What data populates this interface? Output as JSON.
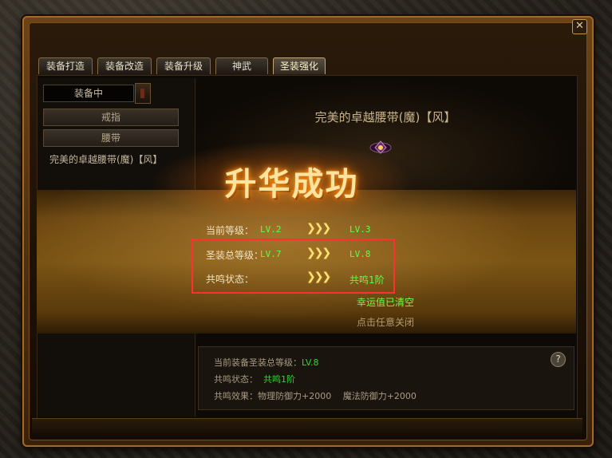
{
  "window": {
    "close_symbol": "✕"
  },
  "tabs": [
    {
      "label": "装备打造",
      "active": false
    },
    {
      "label": "装备改造",
      "active": false
    },
    {
      "label": "装备升级",
      "active": false
    },
    {
      "label": "神武",
      "active": false
    },
    {
      "label": "圣装强化",
      "active": true
    }
  ],
  "sidebar": {
    "filter_value": "装备中",
    "categories": [
      "戒指",
      "腰带"
    ],
    "equipment": "完美的卓越腰带(魔)【风】"
  },
  "item": {
    "name": "完美的卓越腰带(魔)【风】"
  },
  "result": {
    "title": "升华成功",
    "arrows": "❯❯❯",
    "rows": [
      {
        "label": "当前等级：",
        "from": "LV.2",
        "to": "LV.3"
      },
      {
        "label": "圣装总等级：",
        "from": "LV.7",
        "to": "LV.8"
      },
      {
        "label": "共鸣状态：",
        "from": "",
        "to": "共鸣1阶"
      }
    ],
    "lucky_text": "幸运值已清空",
    "close_hint": "点击任意关闭"
  },
  "info": {
    "total_level_label": "当前装备圣装总等级：",
    "total_level_value": "LV.8",
    "resonance_label": "共鸣状态：",
    "resonance_value": "共鸣1阶",
    "effect_label": "共鸣效果：",
    "effect_value": "物理防御力+2000　 魔法防御力+2000",
    "help_symbol": "?"
  },
  "colors": {
    "highlight_border": "#ff3030",
    "value_green": "#5cff4a",
    "title_gold": "#ffe4a0"
  }
}
